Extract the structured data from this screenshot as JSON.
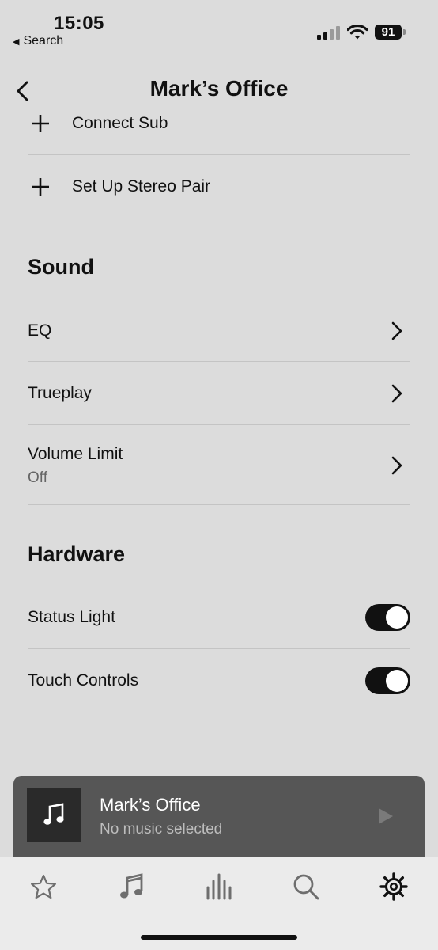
{
  "status_bar": {
    "time": "15:05",
    "back_label": "Search",
    "battery": "91",
    "icons": [
      "signal-icon",
      "wifi-icon",
      "battery-icon"
    ]
  },
  "header": {
    "title": "Mark’s Office",
    "back_icon": "chevron-left-icon"
  },
  "setup_items": [
    {
      "label": "Connect Sub",
      "icon": "plus-icon"
    },
    {
      "label": "Set Up Stereo Pair",
      "icon": "plus-icon"
    }
  ],
  "sound": {
    "title": "Sound",
    "items": [
      {
        "label": "EQ"
      },
      {
        "label": "Trueplay"
      },
      {
        "label": "Volume Limit",
        "sublabel": "Off"
      }
    ]
  },
  "hardware": {
    "title": "Hardware",
    "items": [
      {
        "label": "Status Light",
        "on": true
      },
      {
        "label": "Touch Controls",
        "on": true
      }
    ]
  },
  "now_playing": {
    "room": "Mark’s Office",
    "status": "No music selected",
    "icons": [
      "music-note-icon",
      "play-icon"
    ]
  },
  "tabs": [
    {
      "name": "favorites",
      "icon": "star-icon"
    },
    {
      "name": "browse",
      "icon": "music-note-icon"
    },
    {
      "name": "rooms",
      "icon": "equalizer-bars-icon"
    },
    {
      "name": "search",
      "icon": "search-icon"
    },
    {
      "name": "settings",
      "icon": "gear-icon",
      "active": true
    }
  ],
  "colors": {
    "background": "#dcdcdc",
    "divider": "#c4c4c4",
    "now_playing_bg": "#565656",
    "tabbar_bg": "#ebebeb",
    "toggle_on": "#111111"
  }
}
